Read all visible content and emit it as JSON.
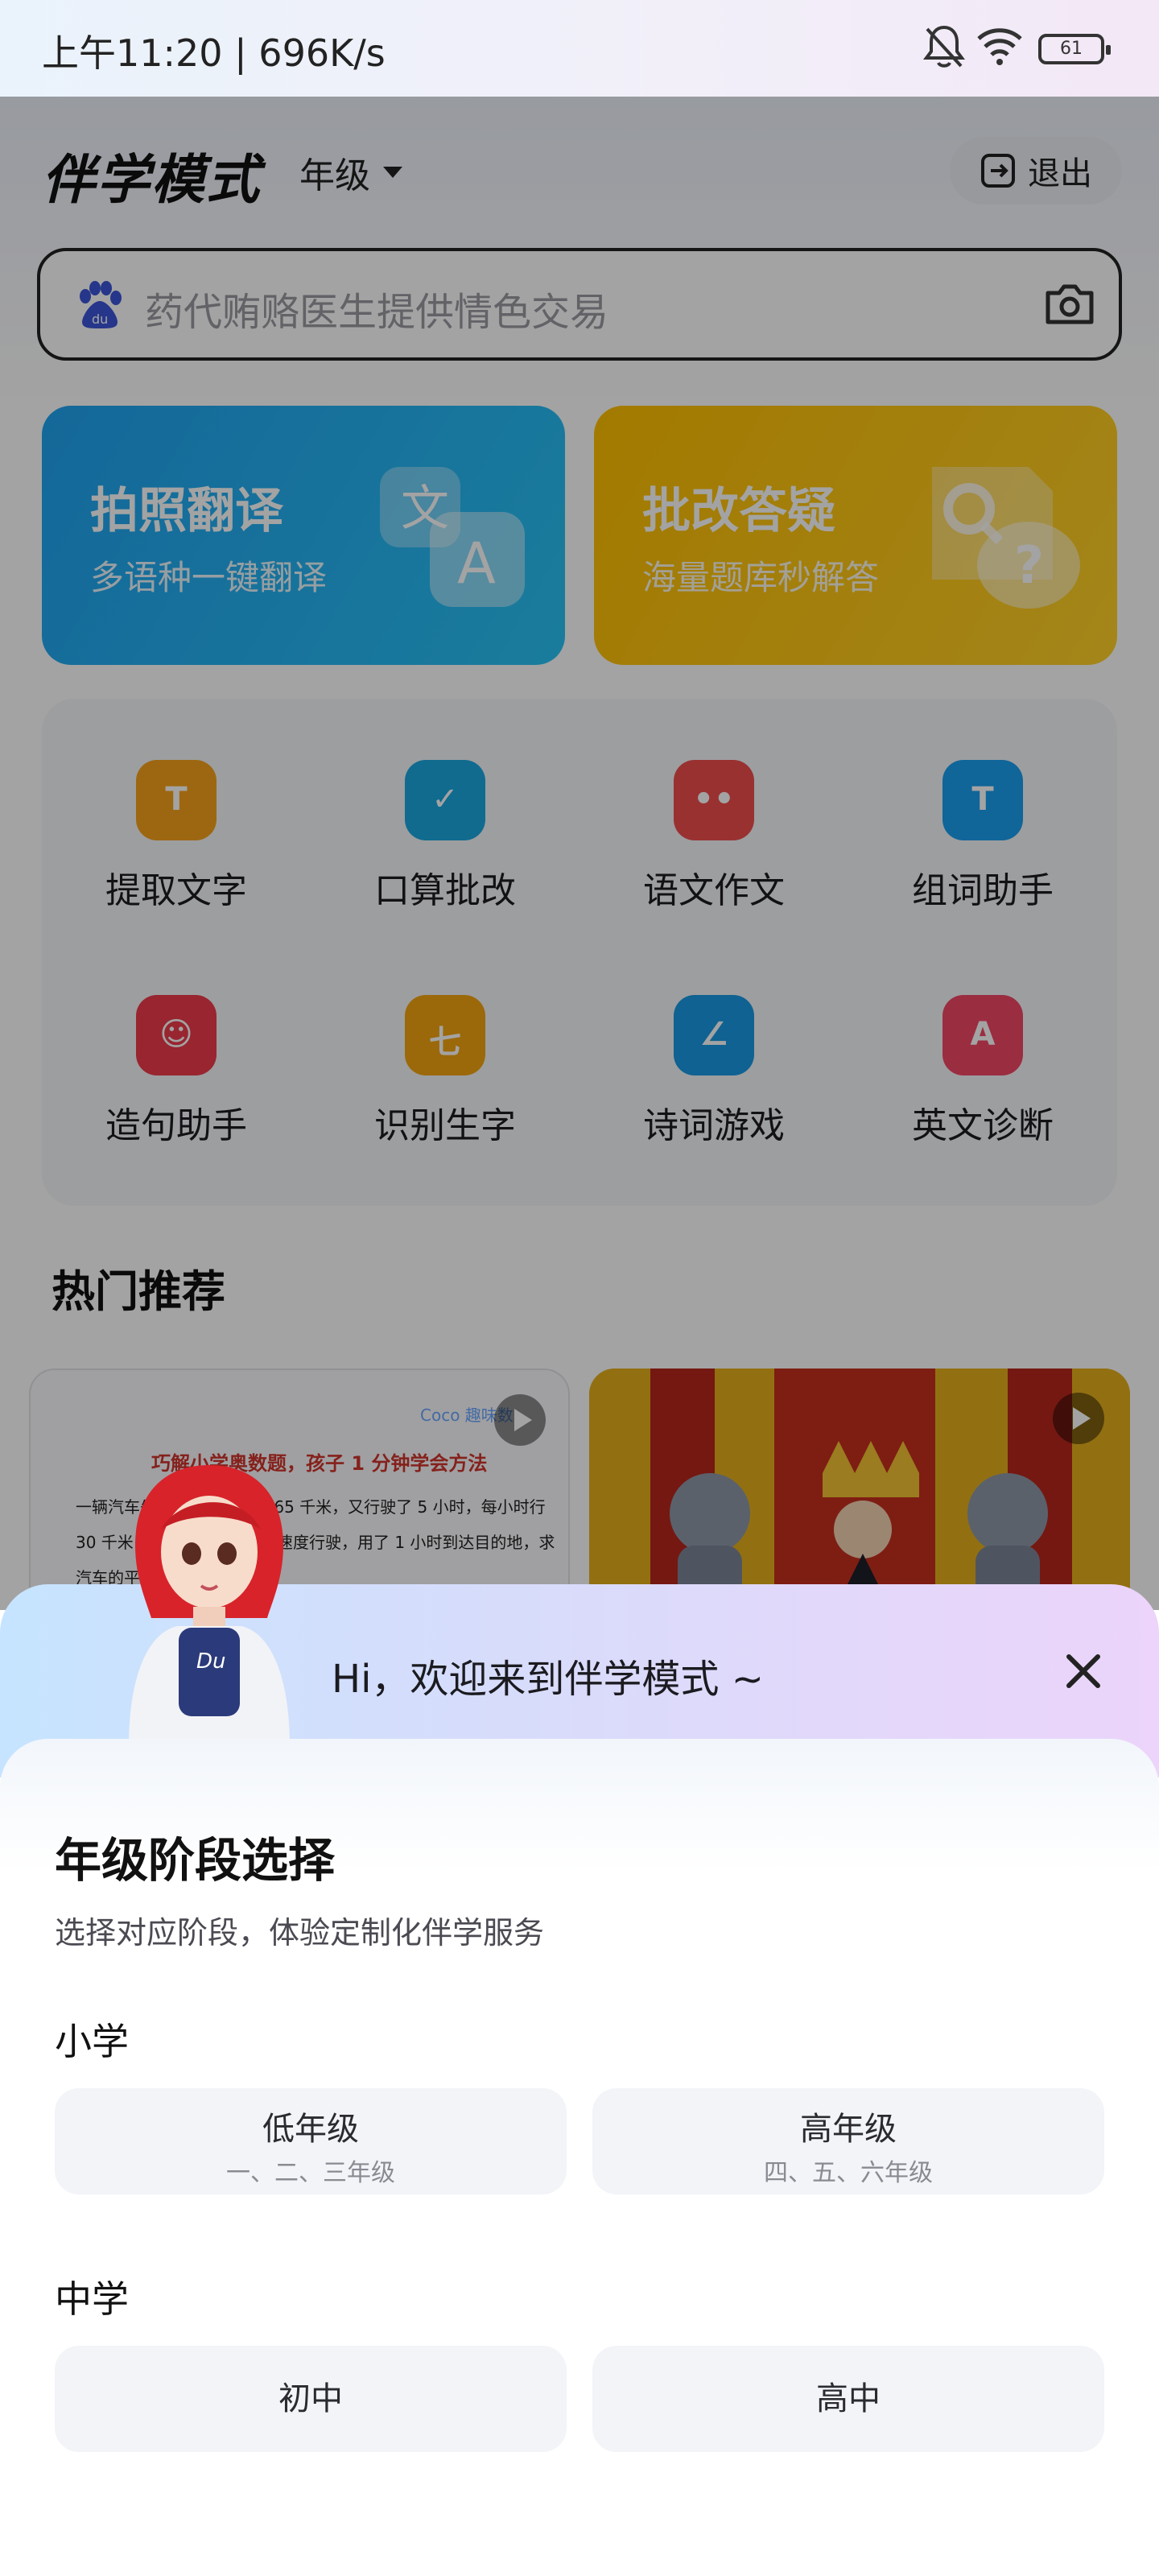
{
  "status_bar": {
    "time": "上午11:20 | 696K/s",
    "battery": "61"
  },
  "header": {
    "title": "伴学模式",
    "grade_selector": "年级",
    "exit_label": "退出"
  },
  "search": {
    "placeholder": "药代贿赂医生提供情色交易"
  },
  "feature_cards": [
    {
      "title": "拍照翻译",
      "subtitle": "多语种一键翻译",
      "color": "#1fa3f0"
    },
    {
      "title": "批改答疑",
      "subtitle": "海量题库秒解答",
      "color": "#ffbf00"
    }
  ],
  "tools": [
    {
      "label": "提取文字",
      "icon": "text-extract-icon",
      "color": "#f6a21b"
    },
    {
      "label": "口算批改",
      "icon": "check-icon",
      "color": "#19a8e0"
    },
    {
      "label": "语文作文",
      "icon": "book-face-icon",
      "color": "#ef4d4d"
    },
    {
      "label": "组词助手",
      "icon": "word-t-icon",
      "color": "#1a9ff0"
    },
    {
      "label": "造句助手",
      "icon": "smile-bubble-icon",
      "color": "#ee3a4a"
    },
    {
      "label": "识别生字",
      "icon": "character-icon",
      "color": "#f3a510"
    },
    {
      "label": "诗词游戏",
      "icon": "scroll-icon",
      "color": "#1899e3"
    },
    {
      "label": "英文诊断",
      "icon": "letter-a-icon",
      "color": "#f34766"
    }
  ],
  "hot": {
    "title": "热门推荐",
    "video1": {
      "brand": "Coco 趣味数",
      "title": "巧解小学奥数题，孩子 1 分钟学会方法",
      "text": "一辆汽车先行驶，每小时行 65 千米，又行驶了 5 小时，每小时行 30 千米，每小时 40 千米的速度行驶，用了 1 小时到达目的地，求汽车的平均速度。"
    }
  },
  "sheet": {
    "welcome": "Hi，欢迎来到伴学模式 ~",
    "title": "年级阶段选择",
    "subtitle": "选择对应阶段，体验定制化伴学服务",
    "primary_label": "小学",
    "primary_options": [
      {
        "label": "低年级",
        "detail": "一、二、三年级"
      },
      {
        "label": "高年级",
        "detail": "四、五、六年级"
      }
    ],
    "middle_label": "中学",
    "middle_options": [
      {
        "label": "初中"
      },
      {
        "label": "高中"
      }
    ]
  }
}
